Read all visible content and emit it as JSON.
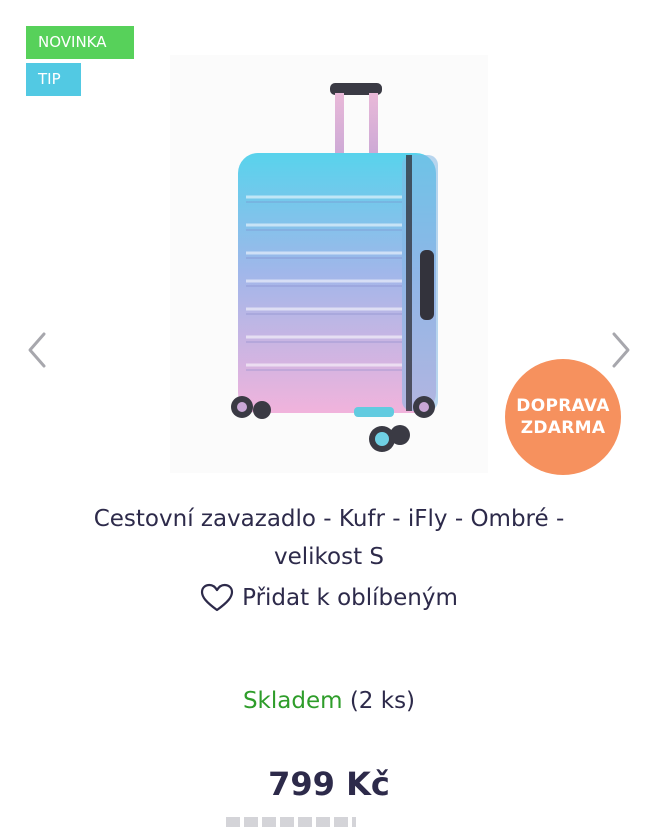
{
  "badges": {
    "new": "NOVINKA",
    "tip": "TIP"
  },
  "colors": {
    "badge_new": "#57d15a",
    "badge_tip": "#52c9e3",
    "shipping_badge": "#f6915e",
    "in_stock": "#2e9d2a",
    "text": "#2d2a4a"
  },
  "shipping_badge": {
    "line1": "DOPRAVA",
    "line2": "ZDARMA"
  },
  "product": {
    "title_line1": "Cestovní zavazadlo - Kufr - iFly - Ombré -",
    "title_line2": "velikost S",
    "image_icon": "suitcase-image",
    "price": "799 Kč"
  },
  "favorite": {
    "label": "Přidat k oblíbeným",
    "icon": "heart-icon"
  },
  "availability": {
    "status": "Skladem",
    "count": "(2 ks)"
  },
  "gallery": {
    "prev_icon": "chevron-left-icon",
    "next_icon": "chevron-right-icon"
  }
}
